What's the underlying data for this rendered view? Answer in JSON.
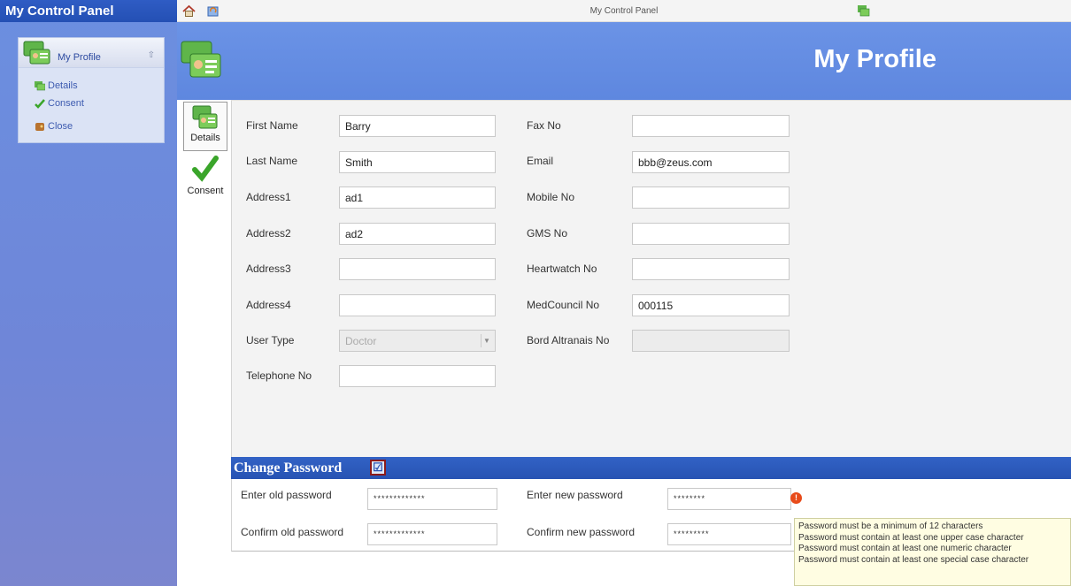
{
  "sidebar": {
    "title": "My Control Panel",
    "section_label": "My Profile",
    "items": [
      {
        "label": "Details",
        "icon": "details-icon"
      },
      {
        "label": "Consent",
        "icon": "checkmark-icon"
      },
      {
        "label": "Close",
        "icon": "close-icon"
      }
    ]
  },
  "topbar": {
    "title": "My Control Panel"
  },
  "header": {
    "title": "My Profile"
  },
  "tabs": [
    {
      "label": "Details"
    },
    {
      "label": "Consent"
    }
  ],
  "form": {
    "first_name": {
      "label": "First Name",
      "value": "Barry"
    },
    "last_name": {
      "label": "Last Name",
      "value": "Smith"
    },
    "address1": {
      "label": "Address1",
      "value": "ad1"
    },
    "address2": {
      "label": "Address2",
      "value": "ad2"
    },
    "address3": {
      "label": "Address3",
      "value": ""
    },
    "address4": {
      "label": "Address4",
      "value": ""
    },
    "user_type": {
      "label": "User Type",
      "value": "Doctor"
    },
    "telephone": {
      "label": "Telephone No",
      "value": ""
    },
    "fax": {
      "label": "Fax No",
      "value": ""
    },
    "email": {
      "label": "Email",
      "value": "bbb@zeus.com"
    },
    "mobile": {
      "label": "Mobile No",
      "value": ""
    },
    "gms": {
      "label": "GMS No",
      "value": ""
    },
    "heartwatch": {
      "label": "Heartwatch No",
      "value": ""
    },
    "medcouncil": {
      "label": "MedCouncil No",
      "value": "000115"
    },
    "bord": {
      "label": "Bord Altranais No",
      "value": ""
    }
  },
  "password": {
    "section_title": "Change Password",
    "checkbox": "☑",
    "enter_old_label": "Enter old password",
    "enter_old_value": "*************",
    "confirm_old_label": "Confirm old password",
    "confirm_old_value": "*************",
    "enter_new_label": "Enter new password",
    "enter_new_value": "********",
    "confirm_new_label": "Confirm new password",
    "confirm_new_value": "*********",
    "warning_icon": "!",
    "rules": [
      "Password must be a minimum of 12 characters",
      "Password must contain at least one upper case character",
      "Password must contain at least one numeric character",
      "Password must contain at least one special case character"
    ]
  },
  "colors": {
    "header_blue": "#6b93e6",
    "sidebar_blue": "#6f86d8",
    "section_blue": "#2753b3",
    "check_green": "#3aa52a",
    "warning_red": "#e84b1a"
  }
}
